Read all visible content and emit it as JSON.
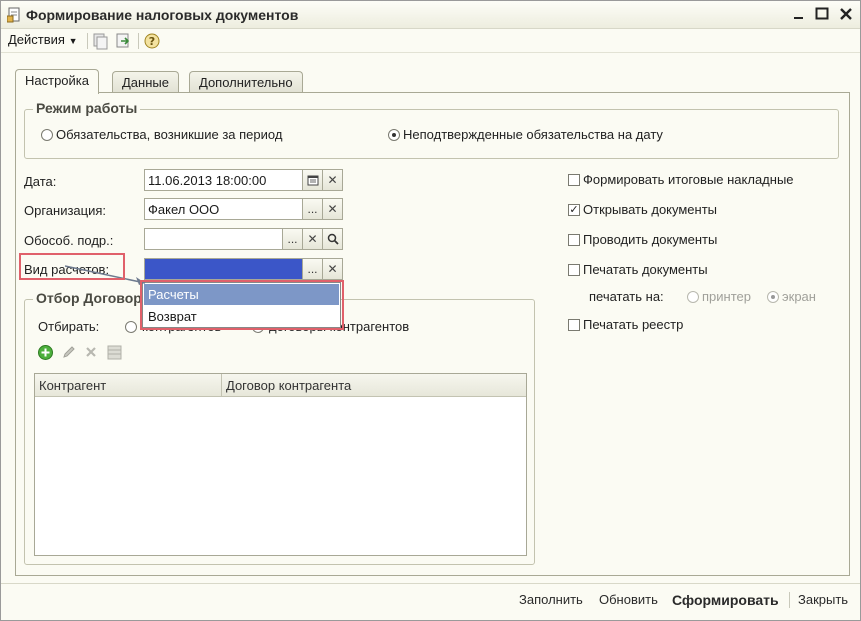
{
  "window": {
    "title": "Формирование налоговых документов"
  },
  "toolbar": {
    "actions_label": "Действия",
    "help_icon": "help-icon"
  },
  "tabs": [
    {
      "label": "Настройка",
      "active": true
    },
    {
      "label": "Данные",
      "active": false
    },
    {
      "label": "Дополнительно",
      "active": false
    }
  ],
  "mode_group": {
    "title": "Режим работы",
    "options": [
      {
        "label": "Обязательства, возникшие за период",
        "checked": false
      },
      {
        "label": "Неподтвержденные обязательства на дату",
        "checked": true
      }
    ]
  },
  "form": {
    "date_label": "Дата:",
    "date_value": "11.06.2013 18:00:00",
    "org_label": "Организация:",
    "org_value": "Факел ООО",
    "subdiv_label": "Обособ. подр.:",
    "subdiv_value": "",
    "settle_label": "Вид расчетов:",
    "settle_value": ""
  },
  "dropdown": {
    "items": [
      {
        "label": "Расчеты",
        "selected": true
      },
      {
        "label": "Возврат",
        "selected": false
      }
    ]
  },
  "filter_group": {
    "title": "Отбор Договор",
    "select_label": "Отбирать:",
    "option_counterparties": "контрагентов",
    "option_contracts": "договоры контрагентов",
    "columns": [
      "Контрагент",
      "Договор контрагента"
    ]
  },
  "options": {
    "summary_invoices": {
      "label": "Формировать итоговые накладные",
      "checked": false
    },
    "open_docs": {
      "label": "Открывать документы",
      "checked": true
    },
    "post_docs": {
      "label": "Проводить документы",
      "checked": false
    },
    "print_docs": {
      "label": "Печатать документы",
      "checked": false
    },
    "print_on_label": "печатать на:",
    "printer_label": "принтер",
    "screen_label": "экран",
    "print_registry": {
      "label": "Печатать реестр",
      "checked": false
    }
  },
  "bottom": {
    "fill": "Заполнить",
    "refresh": "Обновить",
    "generate": "Сформировать",
    "close": "Закрыть"
  },
  "colors": {
    "accent_blue": "#3b56c8",
    "selection": "#7d97c7",
    "highlight": "#e0606a"
  }
}
